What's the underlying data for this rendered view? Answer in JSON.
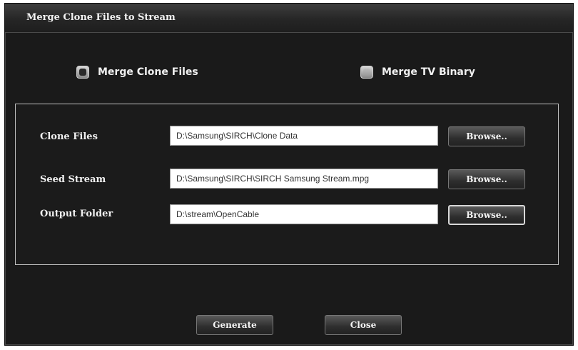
{
  "window": {
    "title": "Merge Clone Files to Stream"
  },
  "mode": {
    "options": [
      {
        "label": "Merge Clone Files",
        "selected": true
      },
      {
        "label": "Merge TV Binary",
        "selected": false
      }
    ]
  },
  "form": {
    "rows": [
      {
        "label": "Clone Files",
        "value": "D:\\Samsung\\SIRCH\\Clone Data",
        "browse_label": "Browse.."
      },
      {
        "label": "Seed Stream",
        "value": "D:\\Samsung\\SIRCH\\SIRCH Samsung Stream.mpg",
        "browse_label": "Browse.."
      },
      {
        "label": "Output Folder",
        "value": "D:\\stream\\OpenCable",
        "browse_label": "Browse.."
      }
    ]
  },
  "actions": {
    "generate_label": "Generate",
    "close_label": "Close"
  },
  "colors": {
    "window_bg": "#1a1a1a",
    "text": "#f0f0f0",
    "field_bg": "#ffffff"
  }
}
